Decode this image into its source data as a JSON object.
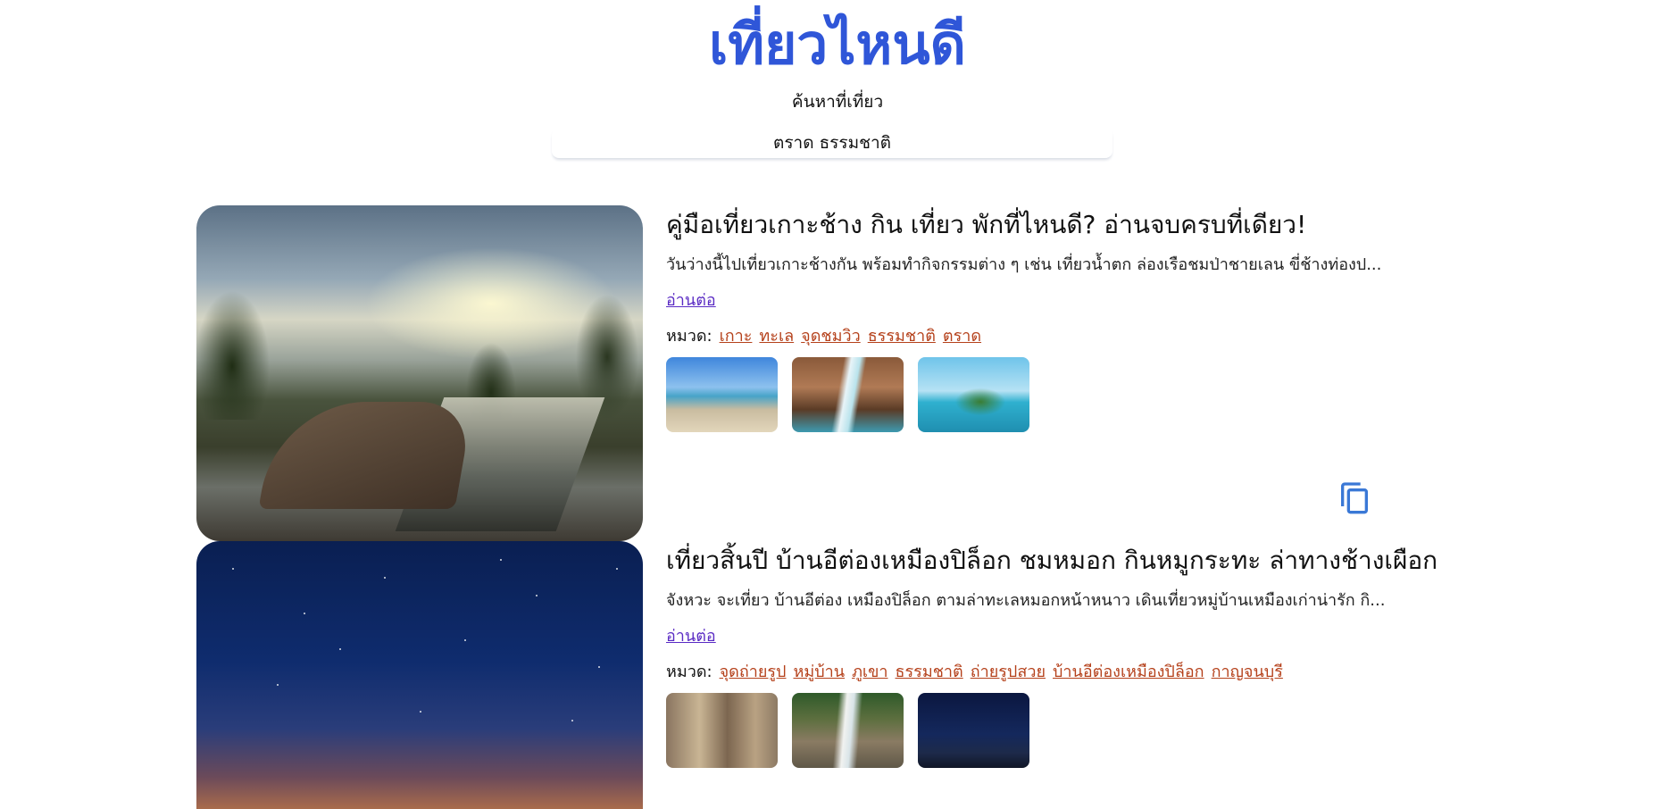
{
  "header": {
    "title": "เที่ยวไหนดี",
    "search_label": "ค้นหาที่เที่ยว",
    "search_value": "ตราด ธรรมชาติ"
  },
  "colors": {
    "title": "#2f56d8",
    "link": "#5a2bc4",
    "tag": "#b5411b",
    "copy_icon": "#3a78d6"
  },
  "results": [
    {
      "title": "คู่มือเที่ยวเกาะช้าง กิน เที่ยว พักที่ไหนดี? อ่านจบครบที่เดียว!",
      "description": "วันว่างนี้ไปเที่ยวเกาะช้างกัน พร้อมทำกิจกรรมต่าง ๆ เช่น เที่ยวน้ำตก ล่องเรือชมป่าชายเลน ขี่ช้างท่องป...",
      "read_more": "อ่านต่อ",
      "category_label": "หมวด:",
      "tags": [
        "เกาะ",
        "ทะเล",
        "จุดชมวิว",
        "ธรรมชาติ",
        "ตราด"
      ]
    },
    {
      "title": "เที่ยวสิ้นปี บ้านอีต่องเหมืองปิล็อก ชมหมอก กินหมูกระทะ ล่าทางช้างเผือก",
      "description": "จังหวะ จะเที่ยว บ้านอีต่อง เหมืองปิล็อก ตามล่าทะเลหมอกหน้าหนาว เดินเที่ยวหมู่บ้านเหมืองเก่าน่ารัก กิ...",
      "read_more": "อ่านต่อ",
      "category_label": "หมวด:",
      "tags": [
        "จุดถ่ายรูป",
        "หมู่บ้าน",
        "ภูเขา",
        "ธรรมชาติ",
        "ถ่ายรูปสวย",
        "บ้านอีต่องเหมืองปิล็อก",
        "กาญจนบุรี"
      ]
    }
  ]
}
